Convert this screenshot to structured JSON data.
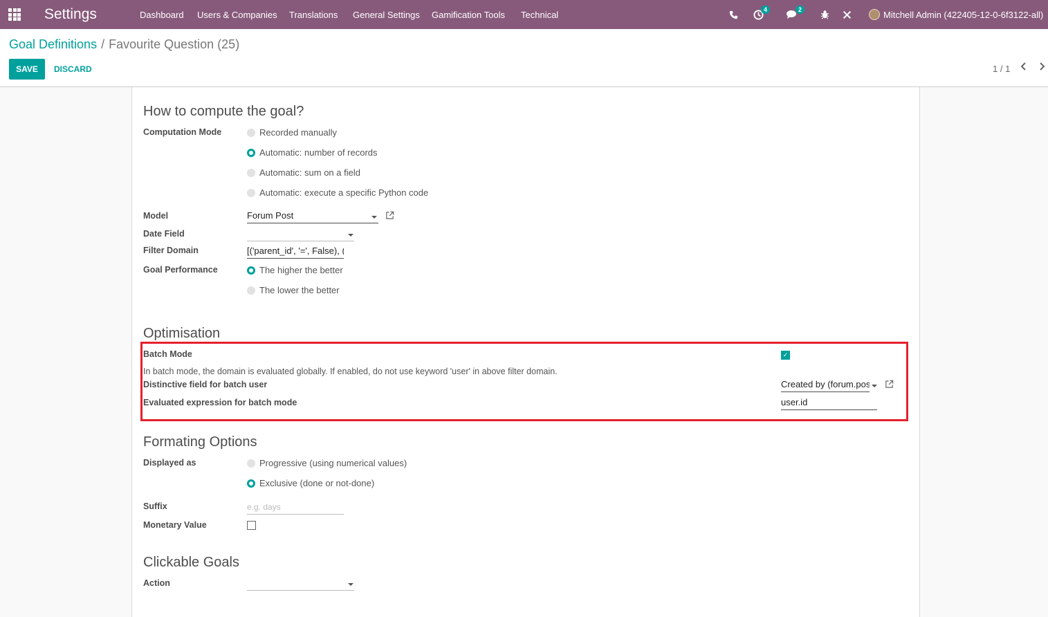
{
  "navbar": {
    "brand": "Settings",
    "menu": [
      "Dashboard",
      "Users & Companies",
      "Translations",
      "General Settings",
      "Gamification Tools",
      "Technical"
    ],
    "activity_badge": "4",
    "messages_badge": "2",
    "user": "Mitchell Admin (422405-12-0-6f3122-all)"
  },
  "breadcrumb": {
    "parent": "Goal Definitions",
    "separator": "/",
    "current": "Favourite Question (25)"
  },
  "buttons": {
    "save": "SAVE",
    "discard": "DISCARD"
  },
  "pager": {
    "value": "1 / 1"
  },
  "compute": {
    "title": "How to compute the goal?",
    "mode_label": "Computation Mode",
    "modes": [
      {
        "label": "Recorded manually",
        "selected": false
      },
      {
        "label": "Automatic: number of records",
        "selected": true
      },
      {
        "label": "Automatic: sum on a field",
        "selected": false
      },
      {
        "label": "Automatic: execute a specific Python code",
        "selected": false
      }
    ],
    "model_label": "Model",
    "model_value": "Forum Post",
    "date_field_label": "Date Field",
    "date_field_value": "",
    "filter_label": "Filter Domain",
    "filter_value": "[('parent_id', '=', False), ('t",
    "performance_label": "Goal Performance",
    "performance": [
      {
        "label": "The higher the better",
        "selected": true
      },
      {
        "label": "The lower the better",
        "selected": false
      }
    ]
  },
  "optimisation": {
    "title": "Optimisation",
    "batch_mode_label": "Batch Mode",
    "batch_mode_checked": true,
    "batch_help": "In batch mode, the domain is evaluated globally. If enabled, do not use keyword 'user' in above filter domain.",
    "distinctive_label": "Distinctive field for batch user",
    "distinctive_value": "Created by (forum.post)",
    "evaluated_label": "Evaluated expression for batch mode",
    "evaluated_value": "user.id"
  },
  "formating": {
    "title": "Formating Options",
    "displayed_label": "Displayed as",
    "displayed": [
      {
        "label": "Progressive (using numerical values)",
        "selected": false
      },
      {
        "label": "Exclusive (done or not-done)",
        "selected": true
      }
    ],
    "suffix_label": "Suffix",
    "suffix_placeholder": "e.g. days",
    "monetary_label": "Monetary Value",
    "monetary_checked": false
  },
  "clickable": {
    "title": "Clickable Goals",
    "action_label": "Action",
    "action_value": ""
  },
  "colors": {
    "navbar": "#875a7b",
    "primary": "#00a09d",
    "highlight": "#e5202e"
  },
  "icons": [
    "apps-icon",
    "phone-icon",
    "activity-icon",
    "messages-icon",
    "bug-icon",
    "tools-icon",
    "external-link-icon",
    "chevron-left-icon",
    "chevron-right-icon"
  ]
}
